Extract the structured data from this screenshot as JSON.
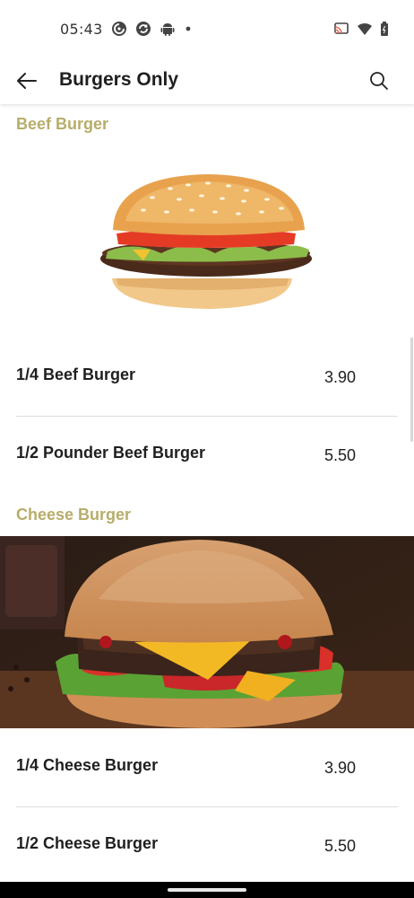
{
  "status_bar": {
    "time": "05:43",
    "left_icons": [
      "pocket-casts-icon",
      "sync-icon",
      "android-icon",
      "dot-icon"
    ],
    "right_icons": [
      "cast-icon",
      "wifi-icon",
      "battery-icon"
    ]
  },
  "app_bar": {
    "title": "Burgers Only",
    "back_icon": "arrow-left-icon",
    "search_icon": "search-icon"
  },
  "sections": [
    {
      "title": "Beef Burger",
      "image": "beef-burger-photo",
      "items": [
        {
          "name": "1/4 Beef Burger",
          "price": "3.90"
        },
        {
          "name": "1/2 Pounder Beef Burger",
          "price": "5.50"
        }
      ]
    },
    {
      "title": "Cheese Burger",
      "image": "cheese-burger-photo",
      "items": [
        {
          "name": "1/4 Cheese Burger",
          "price": "3.90"
        },
        {
          "name": "1/2 Cheese Burger",
          "price": "5.50"
        }
      ]
    }
  ],
  "colors": {
    "section_title": "#b7ad6b",
    "text": "#1f1f1f",
    "divider": "#dcdcdc"
  }
}
